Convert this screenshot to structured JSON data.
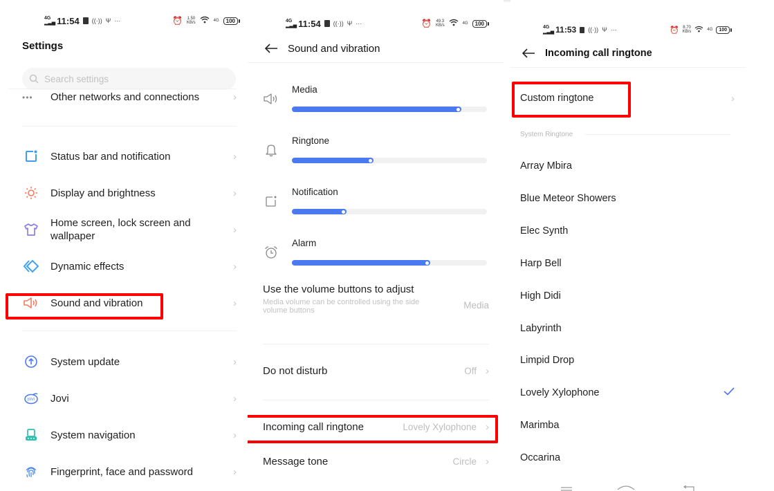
{
  "colors": {
    "accent": "#4a79f0",
    "highlight": "#ff0000",
    "muted_text": "#bdbdbd",
    "divider": "#f0f0f0"
  },
  "panel1": {
    "status": {
      "network": "4G",
      "time": "11:54",
      "speed": "1.50",
      "speed_unit": "KB/s",
      "battery": "100",
      "right_net": "4G"
    },
    "title": "Settings",
    "search": {
      "placeholder": "Search settings",
      "value": ""
    },
    "partial_item": {
      "label": "Other networks and connections",
      "icon": "more-dots-icon"
    },
    "items": [
      {
        "label": "Status bar and notification",
        "icon": "status-bar-icon",
        "icon_color": "#3f9df5"
      },
      {
        "label": "Display and brightness",
        "icon": "brightness-icon",
        "icon_color": "#f47a5e"
      },
      {
        "label": "Home screen, lock screen and wallpaper",
        "icon": "tshirt-icon",
        "icon_color": "#8a7ee8"
      },
      {
        "label": "Dynamic effects",
        "icon": "dynamic-effects-icon",
        "icon_color": "#3fa2f2"
      },
      {
        "label": "Sound and vibration",
        "icon": "speaker-icon",
        "icon_color": "#f47a5e",
        "highlighted": true
      },
      {
        "label": "System update",
        "icon": "system-update-icon",
        "icon_color": "#4a79f0"
      },
      {
        "label": "Jovi",
        "icon": "jovi-icon",
        "icon_color": "#4a79f0"
      },
      {
        "label": "System navigation",
        "icon": "navigation-icon",
        "icon_color": "#2fbfb3"
      },
      {
        "label": "Fingerprint, face and password",
        "icon": "fingerprint-icon",
        "icon_color": "#4a8af0"
      }
    ]
  },
  "panel2": {
    "status": {
      "network": "4G",
      "time": "11:54",
      "speed": "49.3",
      "speed_unit": "KB/s",
      "battery": "100",
      "right_net": "4G"
    },
    "title": "Sound and vibration",
    "volumes": [
      {
        "label": "Media",
        "icon": "speaker-icon",
        "level": 0.87
      },
      {
        "label": "Ringtone",
        "icon": "bell-icon",
        "level": 0.42
      },
      {
        "label": "Notification",
        "icon": "notification-icon",
        "level": 0.28
      },
      {
        "label": "Alarm",
        "icon": "alarm-clock-icon",
        "level": 0.71
      }
    ],
    "volume_buttons": {
      "title": "Use the volume buttons to adjust",
      "subtitle": "Media volume can be controlled using the side volume buttons",
      "value": "Media"
    },
    "rows": [
      {
        "label": "Do not disturb",
        "value": "Off"
      },
      {
        "label": "Incoming call ringtone",
        "value": "Lovely Xylophone",
        "highlighted": true
      },
      {
        "label": "Message tone",
        "value": "Circle"
      }
    ]
  },
  "panel3": {
    "status": {
      "network": "4G",
      "time": "11:53",
      "speed": "8.70",
      "speed_unit": "KB/s",
      "battery": "100",
      "right_net": "4G"
    },
    "title": "Incoming call ringtone",
    "custom": {
      "label": "Custom ringtone",
      "highlighted": true
    },
    "section_label": "System Ringtone",
    "ringtones": [
      {
        "label": "Array Mbira",
        "selected": false
      },
      {
        "label": "Blue Meteor Showers",
        "selected": false
      },
      {
        "label": "Elec Synth",
        "selected": false
      },
      {
        "label": "Harp Bell",
        "selected": false
      },
      {
        "label": "High Didi",
        "selected": false
      },
      {
        "label": "Labyrinth",
        "selected": false
      },
      {
        "label": "Limpid Drop",
        "selected": false
      },
      {
        "label": "Lovely Xylophone",
        "selected": true
      },
      {
        "label": "Marimba",
        "selected": false
      },
      {
        "label": "Occarina",
        "selected": false
      }
    ],
    "nav": [
      "menu-icon",
      "home-icon",
      "back-icon"
    ]
  },
  "status_icons": {
    "ellipsis": "···"
  }
}
